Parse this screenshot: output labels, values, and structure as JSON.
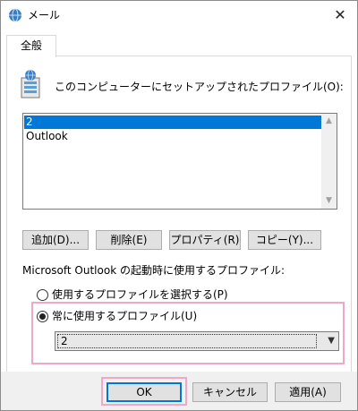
{
  "window": {
    "title": "メール",
    "close_glyph": "✕"
  },
  "tab": {
    "label": "全般"
  },
  "profiles": {
    "label": "このコンピューターにセットアップされたプロファイル(O):",
    "items": [
      {
        "label": "2",
        "selected": true
      },
      {
        "label": "Outlook",
        "selected": false
      }
    ]
  },
  "actions": {
    "add": "追加(D)...",
    "delete": "削除(E)",
    "properties": "プロパティ(R)",
    "copy": "コピー(Y)..."
  },
  "startup": {
    "label": "Microsoft Outlook の起動時に使用するプロファイル:",
    "option_prompt": "使用するプロファイルを選択する(P)",
    "option_always": "常に使用するプロファイル(U)",
    "selected_option": "always",
    "always_profile_value": "2"
  },
  "footer": {
    "ok": "OK",
    "cancel": "キャンセル",
    "apply": "適用(A)"
  },
  "colors": {
    "selection": "#0078d7",
    "highlight": "#f0a8c8"
  }
}
